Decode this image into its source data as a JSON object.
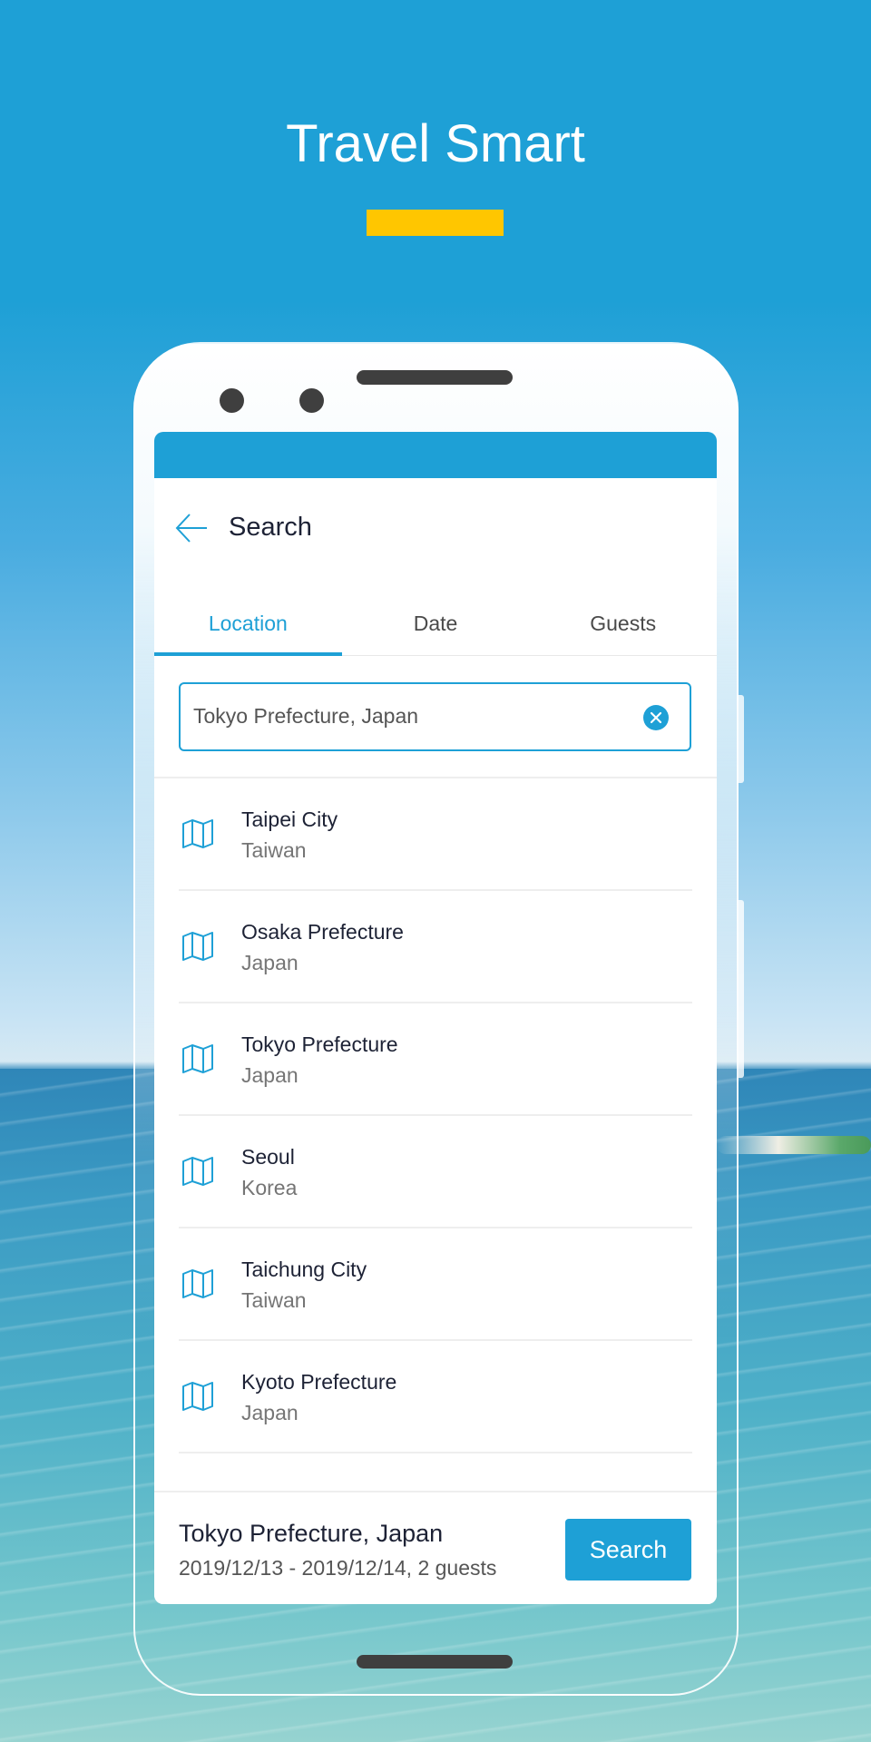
{
  "promo": {
    "title": "Travel Smart",
    "accent_color": "#ffc600",
    "background_color": "#1ea0d6"
  },
  "app": {
    "header": {
      "title": "Search",
      "back_icon": "arrow-left-icon"
    },
    "tabs": [
      {
        "label": "Location",
        "active": true
      },
      {
        "label": "Date",
        "active": false
      },
      {
        "label": "Guests",
        "active": false
      }
    ],
    "search": {
      "value": "Tokyo Prefecture, Japan",
      "clear_icon": "clear-circle-icon"
    },
    "results": [
      {
        "name": "Taipei City",
        "country": "Taiwan",
        "icon": "map-icon"
      },
      {
        "name": "Osaka Prefecture",
        "country": "Japan",
        "icon": "map-icon"
      },
      {
        "name": "Tokyo Prefecture",
        "country": "Japan",
        "icon": "map-icon"
      },
      {
        "name": "Seoul",
        "country": "Korea",
        "icon": "map-icon"
      },
      {
        "name": "Taichung City",
        "country": "Taiwan",
        "icon": "map-icon"
      },
      {
        "name": "Kyoto Prefecture",
        "country": "Japan",
        "icon": "map-icon"
      }
    ],
    "footer": {
      "location": "Tokyo Prefecture, Japan",
      "summary": "2019/12/13 - 2019/12/14, 2 guests",
      "search_label": "Search"
    },
    "accent_color": "#1ea0d6"
  }
}
